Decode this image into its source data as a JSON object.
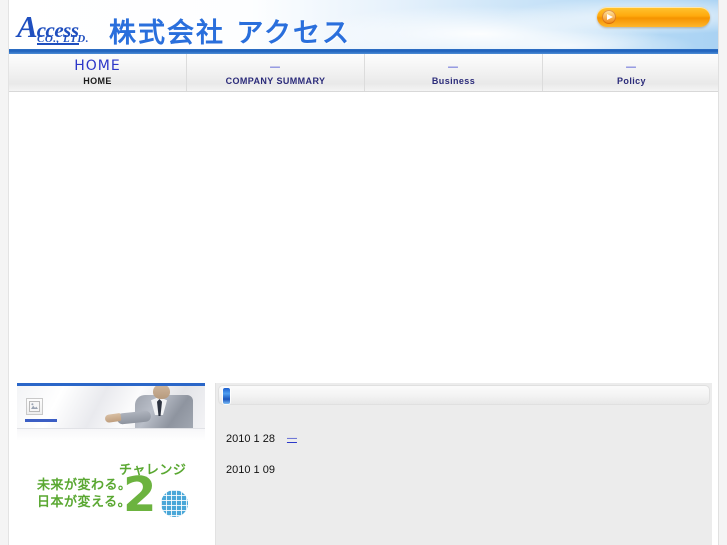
{
  "site": {
    "header": {
      "logo": {
        "initial": "A",
        "word_rest": "ccess",
        "sub": "CO., LTD.",
        "japanese": "株式会社 アクセス"
      },
      "promo_button": {
        "label": "",
        "icon": "play-circle-icon",
        "color": "#ffa90d"
      },
      "rule_color": "#1f63bd"
    },
    "nav": {
      "items": [
        {
          "jp": "HOME",
          "en": "HOME",
          "active": true
        },
        {
          "jp": "—",
          "en": "COMPANY SUMMARY",
          "active": false
        },
        {
          "jp": "—",
          "en": "Business",
          "active": false
        },
        {
          "jp": "—",
          "en": "Policy",
          "active": false
        }
      ]
    },
    "main": {
      "hero": {
        "alt_icon": "broken-image-icon",
        "caption": ""
      },
      "challenge25": {
        "katakana": "チャレンジ",
        "number": "2",
        "line1": "未来が変わる。",
        "line2": "日本が変える。",
        "green": "#6cb33f",
        "blue": "#4aa7d8"
      },
      "news": {
        "title": "",
        "items": [
          {
            "date": "2010 1 28",
            "link": "—"
          },
          {
            "date": "2010 1 09",
            "link": ""
          }
        ]
      }
    }
  }
}
